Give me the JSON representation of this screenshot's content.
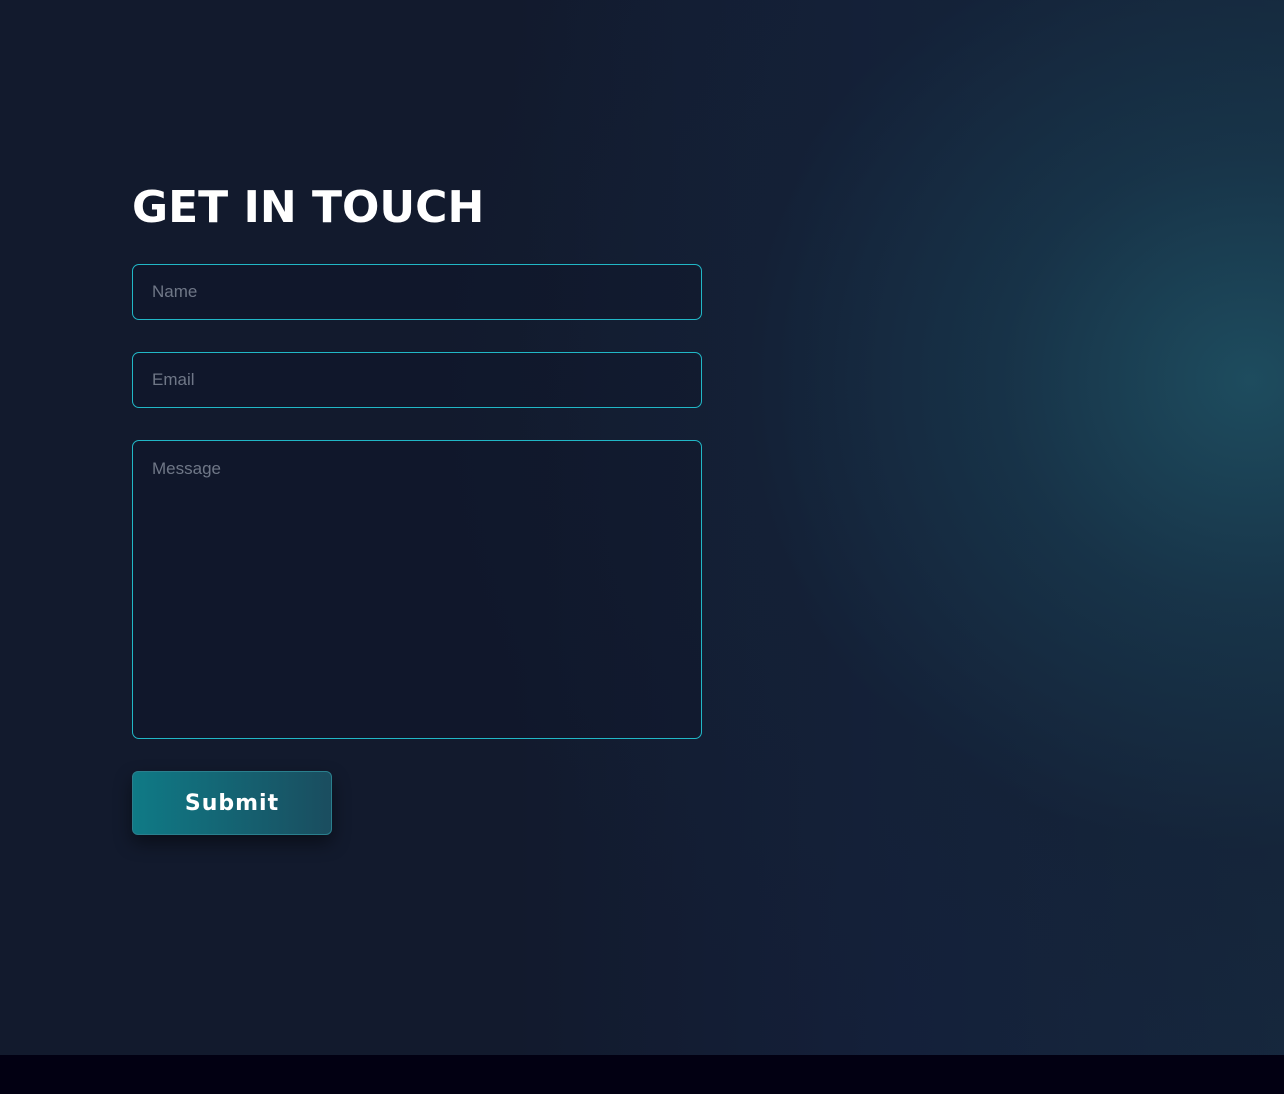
{
  "contact": {
    "title": "GET IN TOUCH",
    "name_placeholder": "Name",
    "email_placeholder": "Email",
    "message_placeholder": "Message",
    "submit_label": "Submit"
  },
  "colors": {
    "accent_border": "#21b7c6",
    "button_start": "#0f7a86",
    "button_end": "#1a4d5f",
    "background": "#121a2d",
    "footer": "#020012"
  }
}
